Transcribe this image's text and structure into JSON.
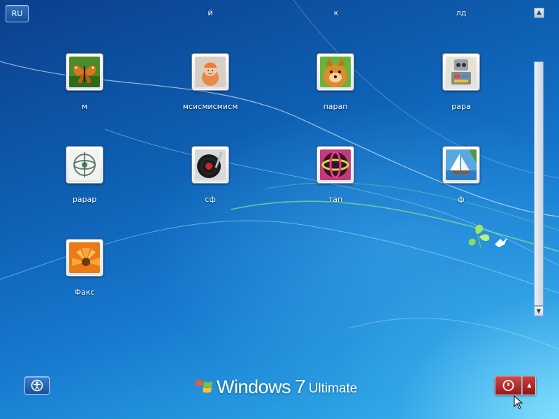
{
  "language_button": {
    "label": "RU"
  },
  "column_headers": [
    "й",
    "к",
    "лд"
  ],
  "corner_icon": "restore-icon",
  "users": [
    {
      "name": "м",
      "picture": "butterfly"
    },
    {
      "name": "мсисмисмисм",
      "picture": "figurine"
    },
    {
      "name": "парап",
      "picture": "puppy"
    },
    {
      "name": "рара",
      "picture": "robot"
    },
    {
      "name": "рарар",
      "picture": "gyroscope"
    },
    {
      "name": "сф",
      "picture": "turntable"
    },
    {
      "name": "тап",
      "picture": "ball"
    },
    {
      "name": "ф",
      "picture": "sailboat"
    },
    {
      "name": "Факс",
      "picture": "flower"
    }
  ],
  "ease_of_access": {
    "icon": "ease-of-access-icon"
  },
  "logo": {
    "brand": "Windows",
    "version": "7",
    "edition": "Ultimate"
  },
  "power": {
    "icon": "power-icon",
    "options_icon": "triangle-up-icon"
  },
  "colors": {
    "power_red": "#b52626",
    "desktop_blue": "#1679cf"
  }
}
